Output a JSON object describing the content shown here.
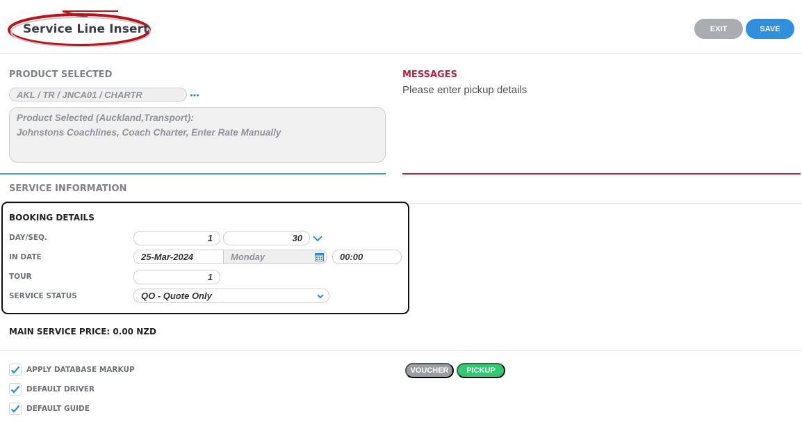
{
  "header": {
    "title": "Service Line Insert",
    "exit_label": "EXIT",
    "save_label": "SAVE"
  },
  "product": {
    "section_label": "PRODUCT SELECTED",
    "code": "AKL / TR / JNCA01 / CHARTR",
    "more_icon": "ellipsis-icon",
    "description_line1": "Product Selected (Auckland,Transport):",
    "description_line2": "Johnstons Coachlines, Coach Charter, Enter Rate Manually"
  },
  "messages": {
    "section_label": "MESSAGES",
    "text": "Please enter pickup details"
  },
  "service_info": {
    "section_label": "SERVICE INFORMATION"
  },
  "booking": {
    "title": "BOOKING DETAILS",
    "day_seq_label": "DAY/SEQ.",
    "day_value": "1",
    "seq_value": "30",
    "in_date_label": "IN DATE",
    "in_date_value": "25-Mar-2024",
    "weekday_value": "Monday",
    "time_value": "00:00",
    "tour_label": "TOUR",
    "tour_value": "1",
    "status_label": "SERVICE STATUS",
    "status_value": "QO - Quote Only"
  },
  "price": {
    "text": "MAIN SERVICE PRICE: 0.00 NZD"
  },
  "options": [
    {
      "label": "APPLY DATABASE MARKUP",
      "checked": true
    },
    {
      "label": "DEFAULT DRIVER",
      "checked": true
    },
    {
      "label": "DEFAULT GUIDE",
      "checked": true
    }
  ],
  "tags": {
    "voucher": "VOUCHER",
    "pickup": "PICKUP"
  },
  "colors": {
    "accent_blue": "#2f8fdd",
    "message_red": "#b72040",
    "pickup_green": "#2ecc71",
    "exit_grey": "#a9adb1"
  }
}
